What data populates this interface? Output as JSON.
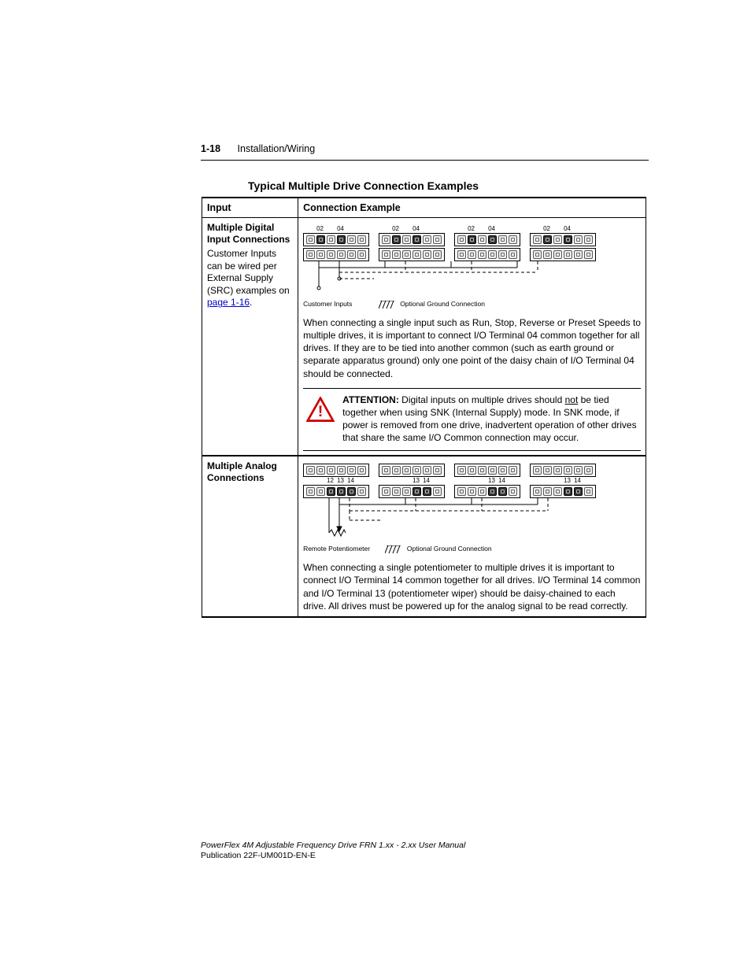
{
  "header": {
    "page_number": "1-18",
    "section": "Installation/Wiring"
  },
  "title": "Typical Multiple Drive Connection Examples",
  "table": {
    "headers": {
      "input": "Input",
      "example": "Connection Example"
    },
    "rows": [
      {
        "input_title": "Multiple Digital Input Connections",
        "input_desc_pre": "Customer Inputs can be wired per External Supply (SRC) examples on ",
        "input_link": "page 1-16",
        "input_desc_post": ".",
        "diagram": {
          "top_labels": [
            "02",
            "04"
          ],
          "left_caption": "Customer Inputs",
          "right_caption": "Optional Ground Connection"
        },
        "paragraph": "When connecting a single input such as Run, Stop, Reverse or Preset Speeds to multiple drives, it is important to connect I/O Terminal 04 common together for all drives. If they are to be tied into another common (such as earth ground or separate apparatus ground) only one point of the daisy chain of I/O Terminal 04 should be connected.",
        "attention_label": "ATTENTION:",
        "attention_pre": "  Digital inputs on multiple drives should ",
        "attention_not": "not",
        "attention_post": " be tied together when using SNK (Internal Supply) mode. In SNK mode, if power is removed from one drive, inadvertent operation of other drives that share the same I/O Common connection may occur."
      },
      {
        "input_title": "Multiple Analog Connections",
        "diagram": {
          "bottom_labels_first": [
            "12",
            "13",
            "14"
          ],
          "bottom_labels_rest": [
            "13",
            "14"
          ],
          "left_caption": "Remote Potentiometer",
          "right_caption": "Optional Ground Connection"
        },
        "paragraph": "When connecting a single potentiometer to multiple drives it is important to connect I/O Terminal 14 common together for all drives. I/O Terminal 14 common and I/O Terminal 13 (potentiometer wiper) should be daisy-chained to each drive. All drives must be powered up for the analog signal to be read correctly."
      }
    ]
  },
  "footer": {
    "line1": "PowerFlex 4M Adjustable Frequency Drive FRN 1.xx - 2.xx User Manual",
    "line2": "Publication 22F-UM001D-EN-E"
  }
}
